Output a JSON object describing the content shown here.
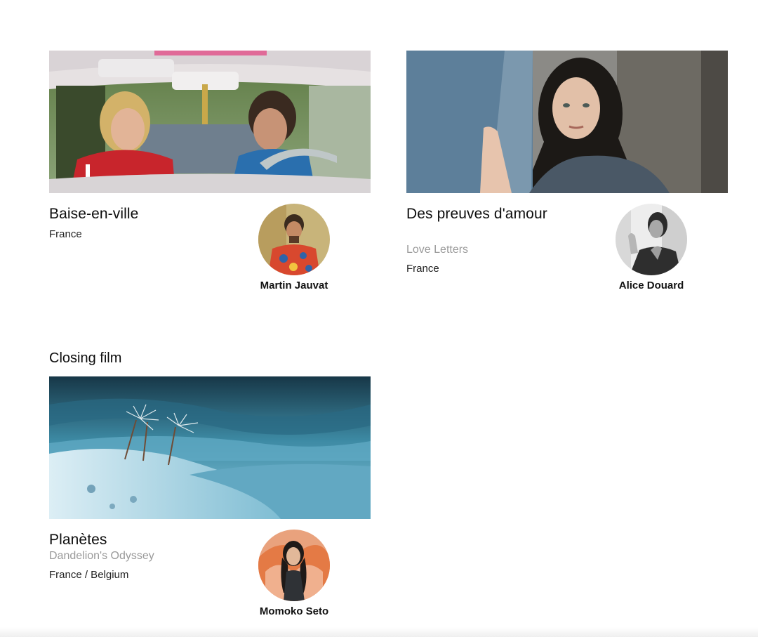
{
  "films": [
    {
      "title": "Baise-en-ville",
      "alt_title": "",
      "country": "France",
      "director": "Martin Jauvat",
      "still_icon": "car-scene-image",
      "avatar_icon": "director-portrait"
    },
    {
      "title": "Des preuves d'amour",
      "alt_title": "Love Letters",
      "country": "France",
      "director": "Alice Douard",
      "still_icon": "woman-portrait-image",
      "avatar_icon": "director-portrait"
    }
  ],
  "closing": {
    "heading": "Closing film",
    "film": {
      "title": "Planètes",
      "alt_title": "Dandelion's Odyssey",
      "country": "France / Belgium",
      "director": "Momoko Seto",
      "still_icon": "dandelion-seeds-image",
      "avatar_icon": "director-portrait"
    }
  },
  "colors": {
    "title": "#0d0d0d",
    "alt_title": "#9a9a9a",
    "text": "#222222"
  }
}
